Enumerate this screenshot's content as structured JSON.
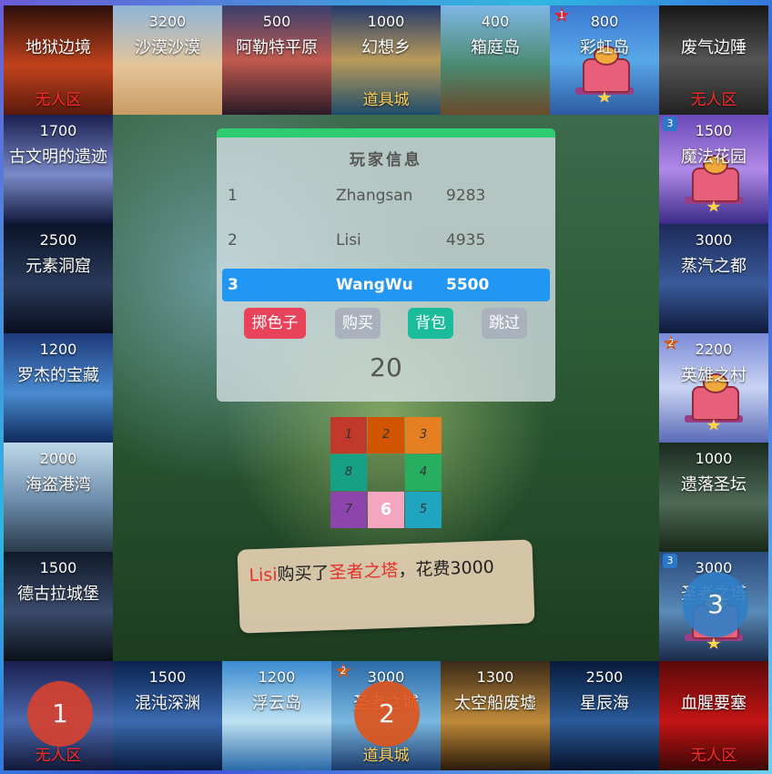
{
  "board": {
    "tiles": [
      {
        "name": "地狱边境",
        "price": "",
        "zone": "无人区",
        "zone_color": "red",
        "bg": "linear-gradient(180deg,#2b0f0a,#c2421c 55%,#5a1a0c)"
      },
      {
        "name": "沙漠沙漠",
        "price": "3200",
        "zone": "",
        "bg": "linear-gradient(180deg,#8fb4d8,#e4c59a 55%,#c99b64)"
      },
      {
        "name": "阿勒特平原",
        "price": "500",
        "zone": "",
        "bg": "linear-gradient(180deg,#3a3f6e,#c05a4e 50%,#2a1a26)"
      },
      {
        "name": "幻想乡",
        "price": "1000",
        "zone": "道具城",
        "zone_color": "gold",
        "bg": "linear-gradient(180deg,#243a6b,#b99a5a 50%,#1e4c6a)"
      },
      {
        "name": "箱庭岛",
        "price": "400",
        "zone": "",
        "bg": "linear-gradient(180deg,#7fb6e6,#4a8a70 55%,#6a4a2a)"
      },
      {
        "name": "彩虹岛",
        "price": "800",
        "zone": "",
        "owner": "1",
        "owner_style": "star",
        "building": true,
        "bg": "linear-gradient(180deg,#3a78d0,#59a8e8 50%,#2d5aa2)"
      },
      {
        "name": "废气边陲",
        "price": "",
        "zone": "无人区",
        "zone_color": "red",
        "bg": "linear-gradient(180deg,#161616,#555 50%,#222)"
      },
      {
        "name": "魔法花园",
        "price": "1500",
        "zone": "",
        "owner": "3",
        "owner_style": "sq",
        "building": true,
        "bg": "linear-gradient(180deg,#6a4ab8,#b18ae8 50%,#3b2a88)"
      },
      {
        "name": "蒸汽之都",
        "price": "3000",
        "zone": "",
        "bg": "linear-gradient(180deg,#1c2a58,#3a5a9a 55%,#0e1a3a)"
      },
      {
        "name": "英雄之村",
        "price": "2200",
        "zone": "",
        "owner": "2",
        "owner_style": "star orange",
        "building": true,
        "bg": "linear-gradient(180deg,#7a8ad8,#c9d4f2 50%,#5a6ab8)"
      },
      {
        "name": "遗落圣坛",
        "price": "1000",
        "zone": "",
        "bg": "linear-gradient(180deg,#1a2a20,#4e6a56 55%,#182818)"
      },
      {
        "name": "圣者之塔",
        "price": "3000",
        "zone": "",
        "owner": "3",
        "owner_style": "sq",
        "building": true,
        "bg": "linear-gradient(180deg,#2a4a7a,#5a8ab8 55%,#1a2a4a)"
      },
      {
        "name": "血腥要塞",
        "price": "",
        "zone": "无人区",
        "zone_color": "red",
        "bg": "linear-gradient(180deg,#5a0a0a,#c41414 55%,#3a0606)"
      },
      {
        "name": "星辰海",
        "price": "2500",
        "zone": "",
        "bg": "linear-gradient(180deg,#071a3a,#2a5a9a 55%,#06122a)"
      },
      {
        "name": "太空船废墟",
        "price": "1300",
        "zone": "",
        "bg": "linear-gradient(180deg,#3a2a18,#c08a3a 55%,#2a1a0a)"
      },
      {
        "name": "圣者之城",
        "price": "3000",
        "zone": "道具城",
        "zone_color": "gold",
        "owner": "2",
        "owner_style": "star orange",
        "bg": "linear-gradient(180deg,#2a6aa8,#7ab8e0 55%,#1a3a6a)"
      },
      {
        "name": "浮云岛",
        "price": "1200",
        "zone": "",
        "bg": "linear-gradient(180deg,#3a8ad0,#bfe2f2 55%,#2a6aa8)"
      },
      {
        "name": "混沌深渊",
        "price": "1500",
        "zone": "",
        "bg": "linear-gradient(180deg,#0a2250,#3a6ab0 55%,#081a3a)"
      },
      {
        "name": "",
        "price": "",
        "zone": "无人区",
        "zone_color": "red",
        "bg": "linear-gradient(180deg,#1a2050,#4a6ab0 55%,#121838)"
      },
      {
        "name": "德古拉城堡",
        "price": "1500",
        "zone": "",
        "bg": "linear-gradient(180deg,#101a2a,#3a4a6a 55%,#0a1018)"
      },
      {
        "name": "海盗港湾",
        "price": "2000",
        "zone": "",
        "bg": "linear-gradient(180deg,#bfd8ea,#6a8aa8 55%,#2a3a4a)"
      },
      {
        "name": "罗杰的宝藏",
        "price": "1200",
        "zone": "",
        "bg": "linear-gradient(180deg,#1e3a7a,#4a8ad0 55%,#0e2a5a)"
      },
      {
        "name": "元素洞窟",
        "price": "2500",
        "zone": "",
        "bg": "linear-gradient(180deg,#0a1428,#2a3a5a 55%,#080e1e)"
      },
      {
        "name": "古文明的遗迹",
        "price": "1700",
        "zone": "",
        "bg": "linear-gradient(180deg,#1a2050,#7a8ac8 55%,#10183a)"
      }
    ]
  },
  "panel": {
    "title": "玩家信息",
    "players": [
      {
        "rank": "1",
        "name": "Zhangsan",
        "money": "9283",
        "active": false
      },
      {
        "rank": "2",
        "name": "Lisi",
        "money": "4935",
        "active": false
      },
      {
        "rank": "3",
        "name": "WangWu",
        "money": "5500",
        "active": true
      }
    ],
    "buttons": {
      "roll": "掷色子",
      "buy": "购买",
      "bag": "背包",
      "skip": "跳过"
    },
    "dice_result": "20"
  },
  "dice_grid": {
    "cells": [
      "1",
      "2",
      "3",
      "8",
      "",
      "4",
      "7",
      "6",
      "5"
    ],
    "colors": [
      "#c0392b",
      "#d35400",
      "#e67e22",
      "#16a085",
      "",
      "#27ae60",
      "#8e44ad",
      "#f4a6c0",
      "#1fa5c0"
    ],
    "current": "6"
  },
  "log": {
    "player": "Lisi",
    "action": "购买了",
    "place": "圣者之塔",
    "suffix": "，花费3000"
  },
  "tokens": [
    {
      "label": "1",
      "color": "#d9412e"
    },
    {
      "label": "2",
      "color": "#e0541a"
    },
    {
      "label": "3",
      "color": "#2f7fc8"
    }
  ],
  "colors": {
    "panel_accent": "#2ecc71",
    "active_row": "#2196f3"
  }
}
